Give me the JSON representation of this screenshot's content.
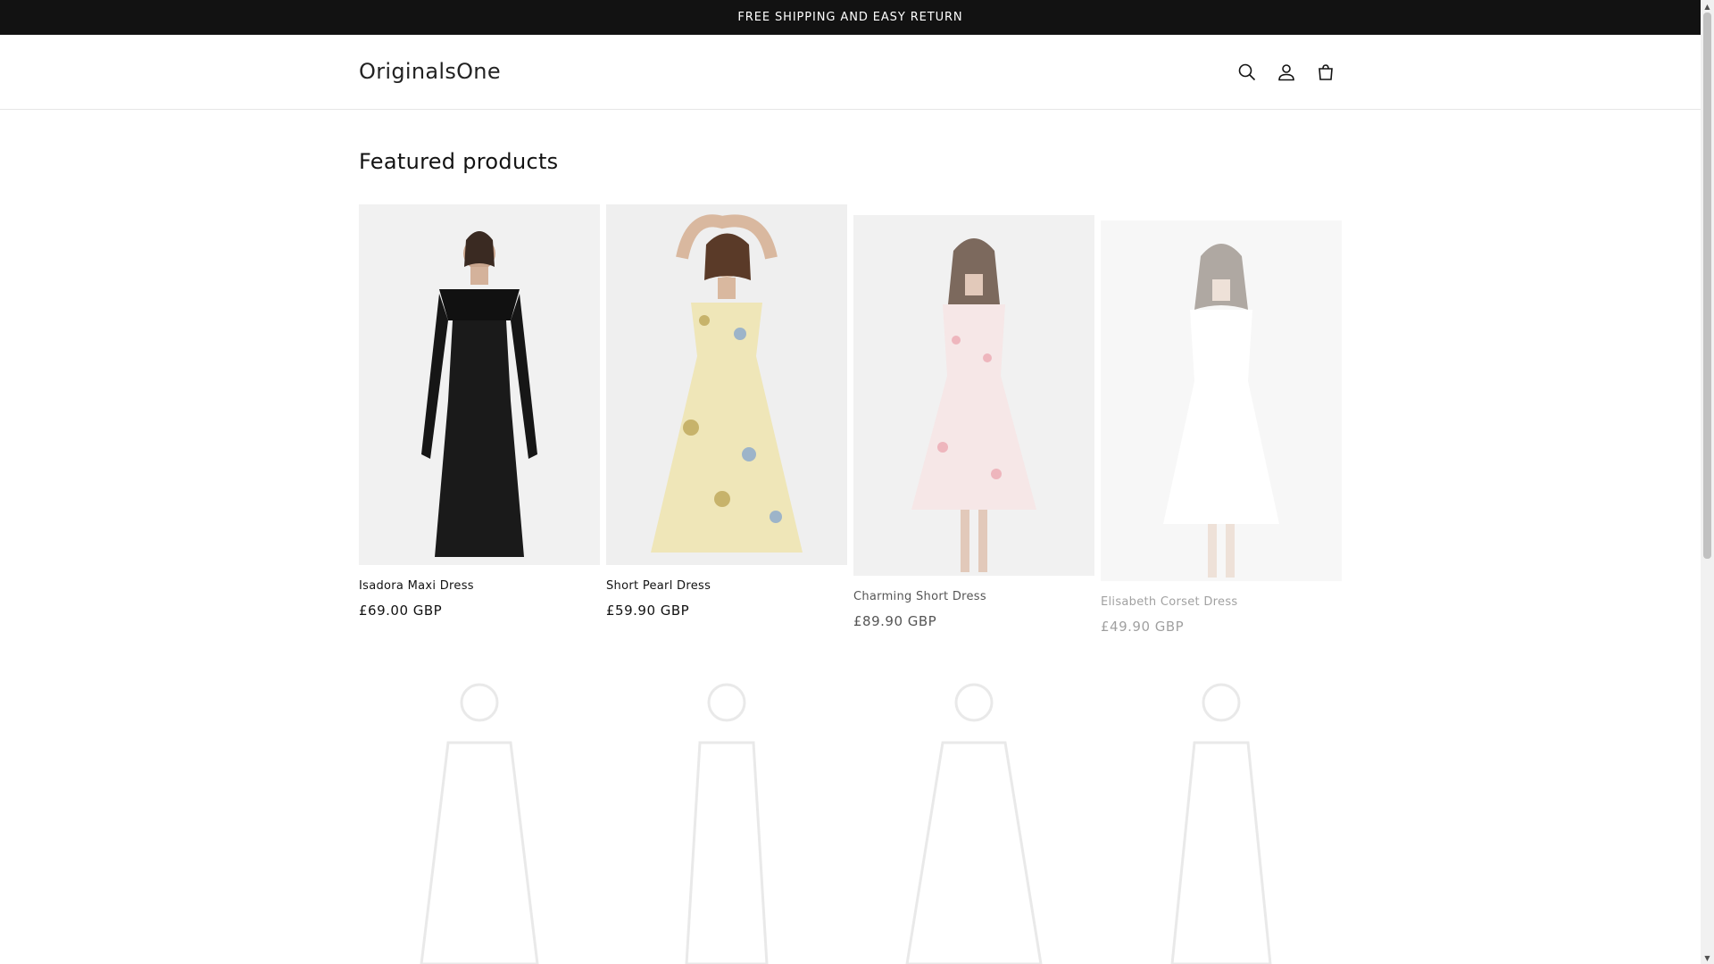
{
  "announcement": {
    "text": "FREE SHIPPING AND EASY RETURN"
  },
  "header": {
    "logo": "OriginalsOne",
    "icons": [
      "search-icon",
      "account-icon",
      "cart-icon"
    ]
  },
  "section": {
    "title": "Featured products"
  },
  "products": [
    {
      "title": "Isadora Maxi Dress",
      "price": "£69.00 GBP",
      "dress_color": "#1a1a1a"
    },
    {
      "title": "Short Pearl Dress",
      "price": "£59.90 GBP",
      "dress_color": "#efe6b8"
    },
    {
      "title": "Charming Short Dress",
      "price": "£89.90 GBP",
      "dress_color": "#f3dede"
    },
    {
      "title": "Elisabeth Corset Dress",
      "price": "£49.90 GBP",
      "dress_color": "#f7f7f7"
    }
  ],
  "colors": {
    "announcement_bg": "#121212",
    "text": "#121212",
    "card_bg": "#f2f2f2"
  }
}
